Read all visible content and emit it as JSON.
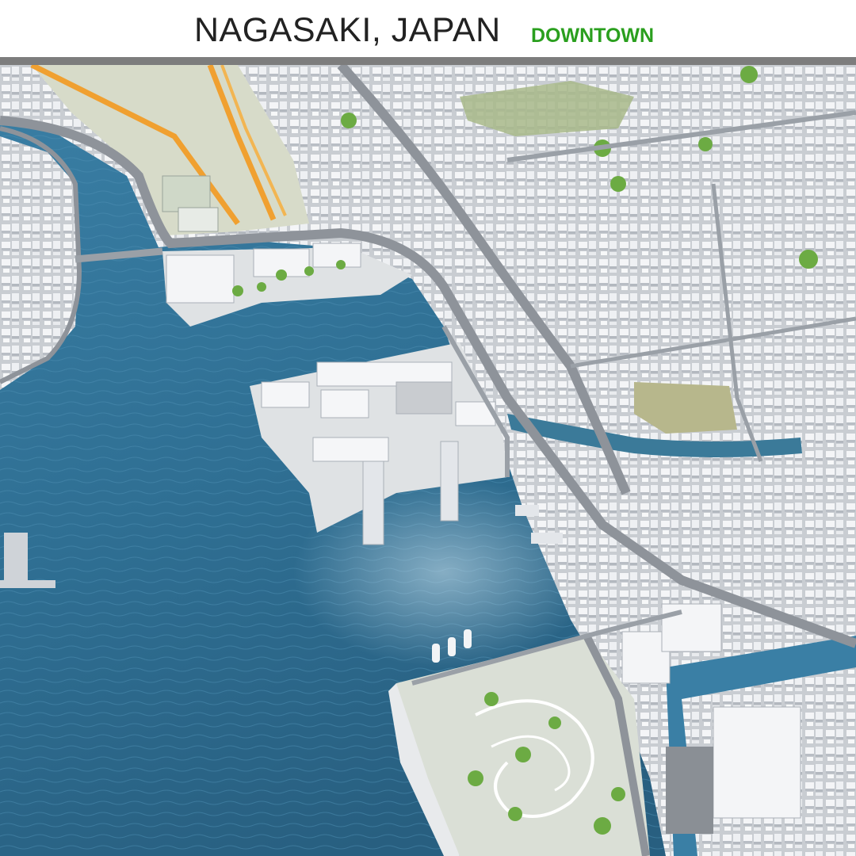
{
  "header": {
    "title": "NAGASAKI, JAPAN",
    "subtitle": "DOWNTOWN"
  },
  "colors": {
    "title_text": "#222222",
    "subtitle_text": "#2a9f1e",
    "divider": "#7d7d7d",
    "water": "#2f6f93",
    "land": "#e2e4e6",
    "road": "#8e939a",
    "building": "#f3f4f6",
    "park": "#6cab43",
    "rail": "#f0a030"
  }
}
